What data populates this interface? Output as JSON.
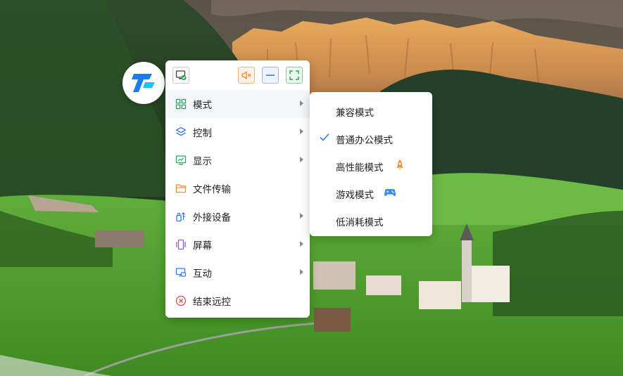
{
  "main_menu": {
    "items": [
      {
        "label": "模式"
      },
      {
        "label": "控制"
      },
      {
        "label": "显示"
      },
      {
        "label": "文件传输"
      },
      {
        "label": "外接设备"
      },
      {
        "label": "屏幕"
      },
      {
        "label": "互动"
      },
      {
        "label": "结束远控"
      }
    ]
  },
  "mode_menu": {
    "items": [
      {
        "label": "兼容模式",
        "selected": false
      },
      {
        "label": "普通办公模式",
        "selected": true
      },
      {
        "label": "高性能模式",
        "badge": "rocket-icon"
      },
      {
        "label": "游戏模式",
        "badge": "gamepad-icon"
      },
      {
        "label": "低消耗模式",
        "selected": false
      }
    ]
  },
  "colors": {
    "accent": "#2f7cf6",
    "mute_button": "#f08c2e",
    "minimize_button": "#3a6fd8",
    "fullscreen_button": "#2aa65a",
    "close_icon": "#e04b4b"
  }
}
